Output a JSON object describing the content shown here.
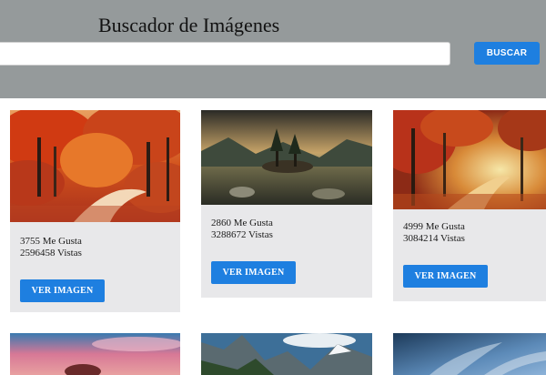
{
  "header": {
    "title": "Buscador de Imágenes",
    "search_placeholder": "",
    "search_value": "",
    "search_button_label": "BUSCAR"
  },
  "cards": [
    {
      "likes_text": "3755 Me Gusta",
      "views_text": "2596458 Vistas",
      "button_label": "VER IMAGEN",
      "image": "autumn-forest-path"
    },
    {
      "likes_text": "2860 Me Gusta",
      "views_text": "3288672 Vistas",
      "button_label": "VER IMAGEN",
      "image": "mountain-lake-island"
    },
    {
      "likes_text": "4999 Me Gusta",
      "views_text": "3084214 Vistas",
      "button_label": "VER IMAGEN",
      "image": "autumn-sunlit-forest"
    }
  ],
  "partial_cards": [
    {
      "image": "pink-sky-tree"
    },
    {
      "image": "alpine-mountains"
    },
    {
      "image": "blue-sky-clouds"
    }
  ],
  "colors": {
    "header_bg": "#959a9b",
    "accent": "#1e7fe0",
    "card_bg": "#e8e8ea"
  }
}
